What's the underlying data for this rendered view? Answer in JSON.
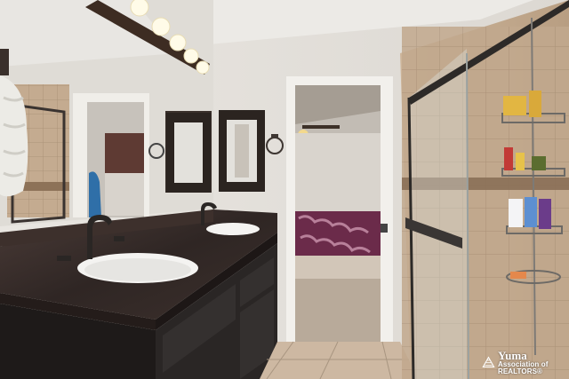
{
  "photo": {
    "subject": "bathroom-double-vanity-with-walk-in-shower",
    "colors": {
      "wall": "#e6e2dc",
      "ceiling": "#eceae6",
      "countertop": "#3b2f2c",
      "cabinet": "#2a2625",
      "tile": "#b9a28a",
      "floor_tile": "#cdb8a2",
      "bedspread": "#6b2b4a",
      "mirror_frame": "#2b2420"
    }
  },
  "watermark": {
    "line1": "Yuma",
    "line2": "Association of REALTORS®"
  }
}
